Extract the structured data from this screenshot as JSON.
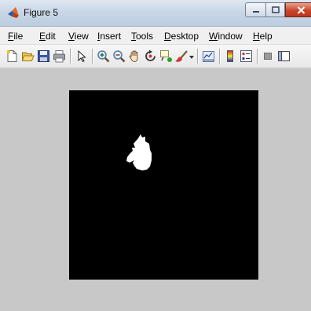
{
  "window": {
    "title": "Figure 5",
    "app_icon": "matlab-logo-icon",
    "controls": [
      "minimize-icon",
      "maximize-icon",
      "close-icon"
    ]
  },
  "menu": {
    "items": [
      {
        "mnemonic": "F",
        "rest": "ile"
      },
      {
        "mnemonic": "E",
        "rest": "dit"
      },
      {
        "mnemonic": "V",
        "rest": "iew"
      },
      {
        "mnemonic": "I",
        "rest": "nsert"
      },
      {
        "mnemonic": "T",
        "rest": "ools"
      },
      {
        "mnemonic": "D",
        "rest": "esktop"
      },
      {
        "mnemonic": "W",
        "rest": "indow"
      },
      {
        "mnemonic": "H",
        "rest": "elp"
      }
    ]
  },
  "toolbar": {
    "icons": [
      "new-figure-icon",
      "open-file-icon",
      "save-icon",
      "print-icon",
      "edit-plot-arrow-icon",
      "zoom-in-icon",
      "zoom-out-icon",
      "pan-hand-icon",
      "rotate-3d-icon",
      "data-cursor-icon",
      "brush-icon",
      "link-plot-icon",
      "colorbar-icon",
      "legend-icon",
      "hide-plot-tools-icon",
      "show-plot-tools-icon"
    ]
  },
  "figure": {
    "background": "#c8c8c8",
    "image_background": "#000000",
    "blob_color": "#ffffff"
  }
}
